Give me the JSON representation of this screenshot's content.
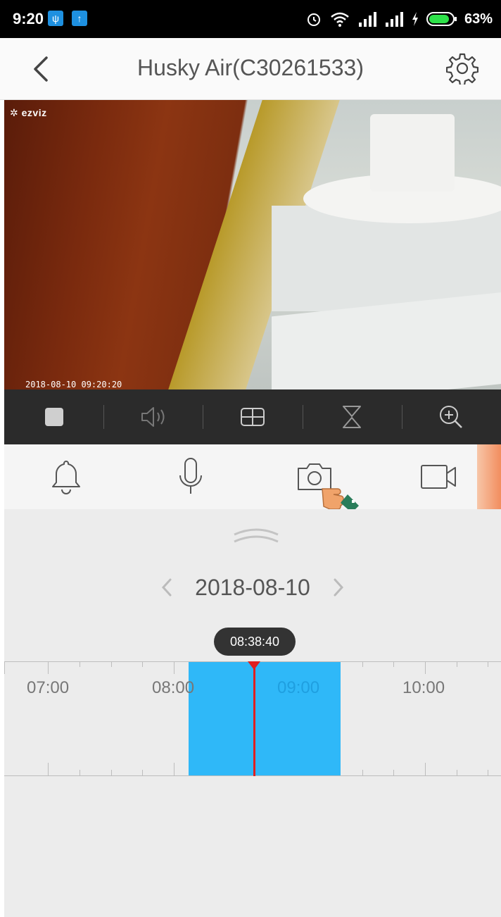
{
  "status_bar": {
    "time": "9:20",
    "battery_pct": "63%",
    "icons": [
      "usb-icon",
      "upload-icon",
      "alarm-icon",
      "wifi-icon",
      "signal-icon",
      "signal-icon",
      "charging-icon",
      "battery-icon"
    ]
  },
  "header": {
    "title": "Husky Air(C30261533)"
  },
  "camera": {
    "logo": "ezviz",
    "timestamp": "2018-08-10 09:20:20"
  },
  "playback": {
    "date": "2018-08-10",
    "current_time": "08:38:40",
    "timeline_labels": [
      "07:00",
      "08:00",
      "09:00",
      "10:00"
    ],
    "recorded_segment_color": "#2fb8f8",
    "cursor_color": "#e02020"
  },
  "colors": {
    "accent": "#2fb8f8",
    "toolbar_bg": "#2b2b2b",
    "status_badge": "#1e90e0"
  }
}
